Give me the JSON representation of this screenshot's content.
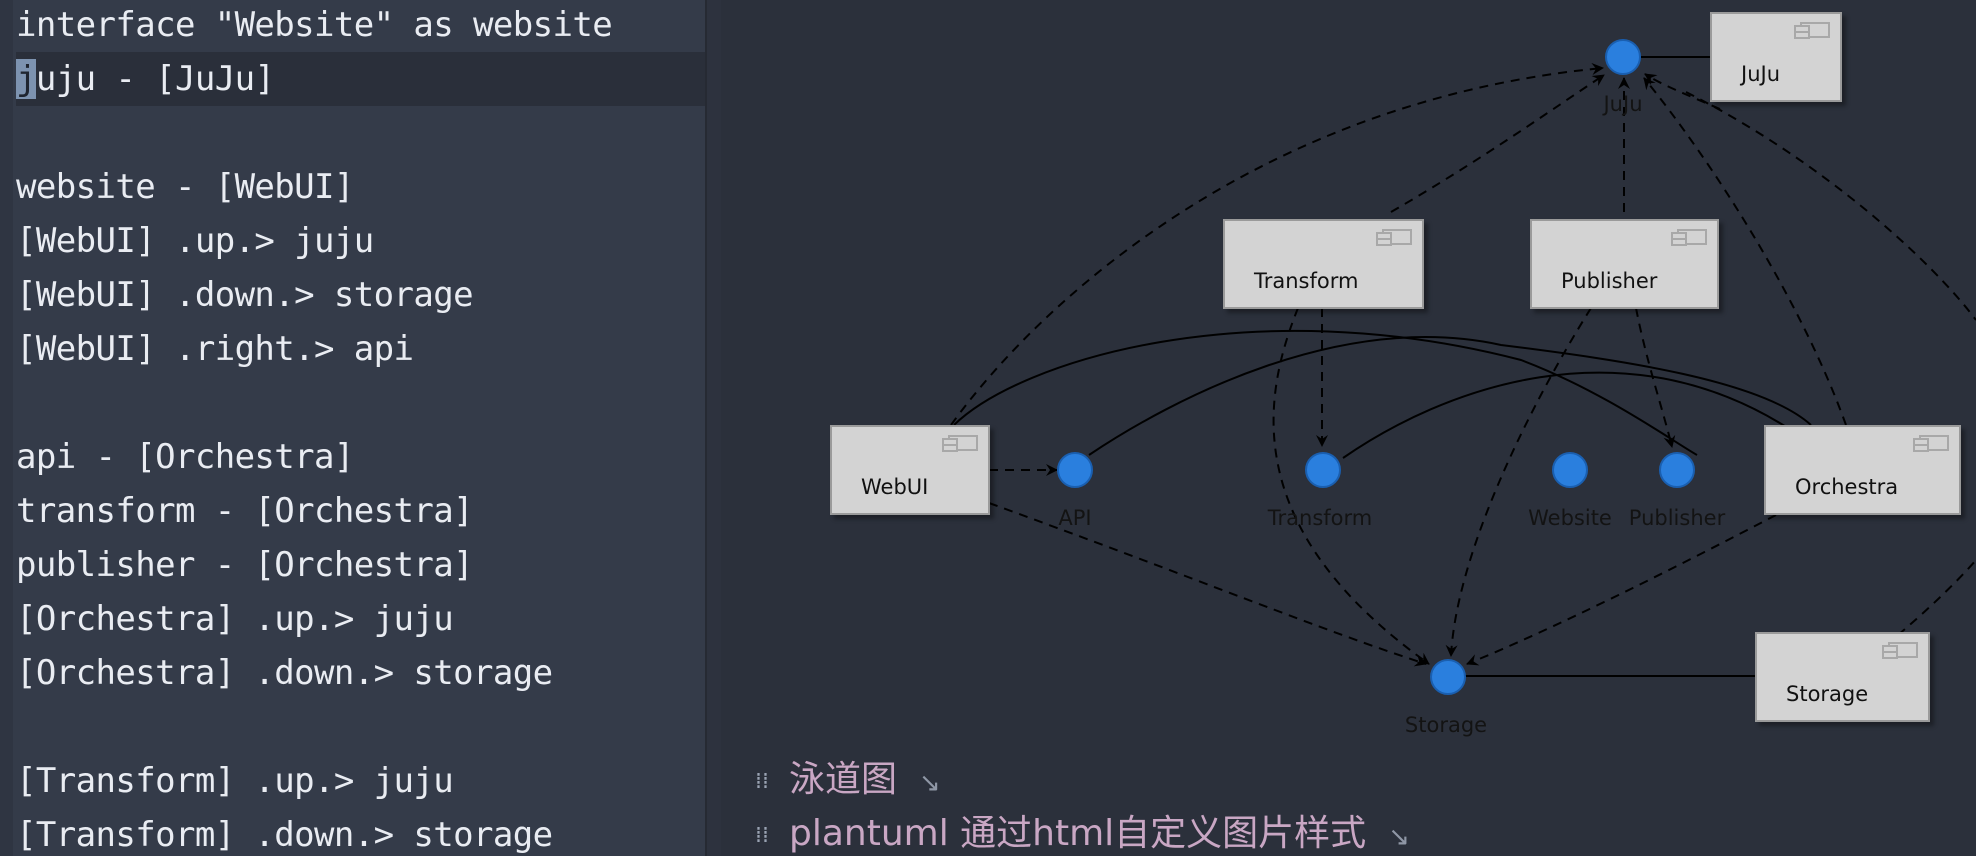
{
  "editor": {
    "lines": [
      "interface \"Website\" as website",
      "juju - [JuJu]",
      "",
      "website - [WebUI]",
      "[WebUI] .up.> juju",
      "[WebUI] .down.> storage",
      "[WebUI] .right.> api",
      "",
      "api - [Orchestra]",
      "transform - [Orchestra]",
      "publisher - [Orchestra]",
      "[Orchestra] .up.> juju",
      "[Orchestra] .down.> storage",
      "",
      "[Transform] .up.> juju",
      "[Transform] .down.> storage"
    ],
    "current_line": 1
  },
  "diagram": {
    "components": [
      {
        "key": "juju",
        "label": "JuJu"
      },
      {
        "key": "transform",
        "label": "Transform"
      },
      {
        "key": "publisher",
        "label": "Publisher"
      },
      {
        "key": "webui",
        "label": "WebUI"
      },
      {
        "key": "orchestra",
        "label": "Orchestra"
      },
      {
        "key": "storage",
        "label": "Storage"
      }
    ],
    "interfaces": [
      {
        "key": "juju",
        "label": "JuJu"
      },
      {
        "key": "api",
        "label": "API"
      },
      {
        "key": "transform",
        "label": "Transform"
      },
      {
        "key": "website",
        "label": "Website"
      },
      {
        "key": "publisher",
        "label": "Publisher"
      },
      {
        "key": "storage",
        "label": "Storage"
      }
    ],
    "colors": {
      "interface": "#2a7fde",
      "component_fill": "#d3d3d3",
      "edge": "#000000"
    }
  },
  "headings": [
    {
      "text": "泳道图"
    },
    {
      "text": "plantuml 通过html自定义图片样式"
    }
  ]
}
